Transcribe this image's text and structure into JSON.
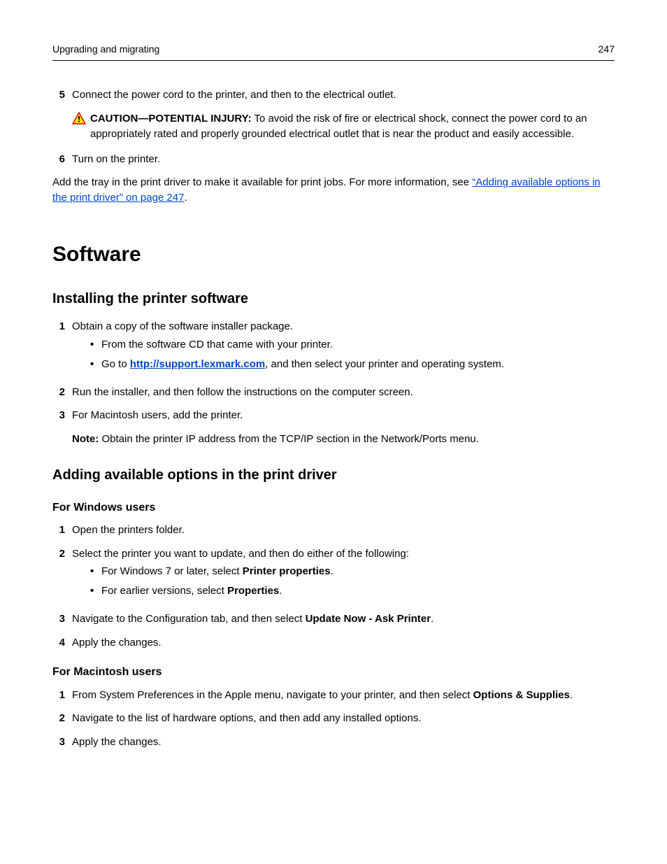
{
  "header": {
    "left": "Upgrading and migrating",
    "right": "247"
  },
  "topSteps": {
    "s5": {
      "num": "5",
      "text": "Connect the power cord to the printer, and then to the electrical outlet."
    },
    "caution": {
      "label": "CAUTION—POTENTIAL INJURY:",
      "text": " To avoid the risk of fire or electrical shock, connect the power cord to an appropriately rated and properly grounded electrical outlet that is near the product and easily accessible."
    },
    "s6": {
      "num": "6",
      "text": "Turn on the printer."
    },
    "afterPara": {
      "pre": "Add the tray in the print driver to make it available for print jobs. For more information, see ",
      "link": "“Adding available options in the print driver” on page 247",
      "post": "."
    }
  },
  "software": {
    "title": "Software",
    "install": {
      "title": "Installing the printer software",
      "s1": {
        "num": "1",
        "text": "Obtain a copy of the software installer package."
      },
      "b1": "From the software CD that came with your printer.",
      "b2pre": "Go to ",
      "b2link": "http://support.lexmark.com",
      "b2post": ", and then select your printer and operating system.",
      "s2": {
        "num": "2",
        "text": "Run the installer, and then follow the instructions on the computer screen."
      },
      "s3": {
        "num": "3",
        "text": "For Macintosh users, add the printer."
      },
      "noteLabel": "Note:",
      "noteText": " Obtain the printer IP address from the TCP/IP section in the Network/Ports menu."
    },
    "adding": {
      "title": "Adding available options in the print driver",
      "win": {
        "title": "For Windows users",
        "s1": {
          "num": "1",
          "text": "Open the printers folder."
        },
        "s2": {
          "num": "2",
          "text": "Select the printer you want to update, and then do either of the following:"
        },
        "b1pre": "For Windows 7 or later, select ",
        "b1bold": "Printer properties",
        "b1post": ".",
        "b2pre": "For earlier versions, select ",
        "b2bold": "Properties",
        "b2post": ".",
        "s3": {
          "num": "3",
          "pre": "Navigate to the Configuration tab, and then select ",
          "bold": "Update Now ‑ Ask Printer",
          "post": "."
        },
        "s4": {
          "num": "4",
          "text": "Apply the changes."
        }
      },
      "mac": {
        "title": "For Macintosh users",
        "s1": {
          "num": "1",
          "pre": "From System Preferences in the Apple menu, navigate to your printer, and then select ",
          "bold": "Options & Supplies",
          "post": "."
        },
        "s2": {
          "num": "2",
          "text": "Navigate to the list of hardware options, and then add any installed options."
        },
        "s3": {
          "num": "3",
          "text": "Apply the changes."
        }
      }
    }
  }
}
